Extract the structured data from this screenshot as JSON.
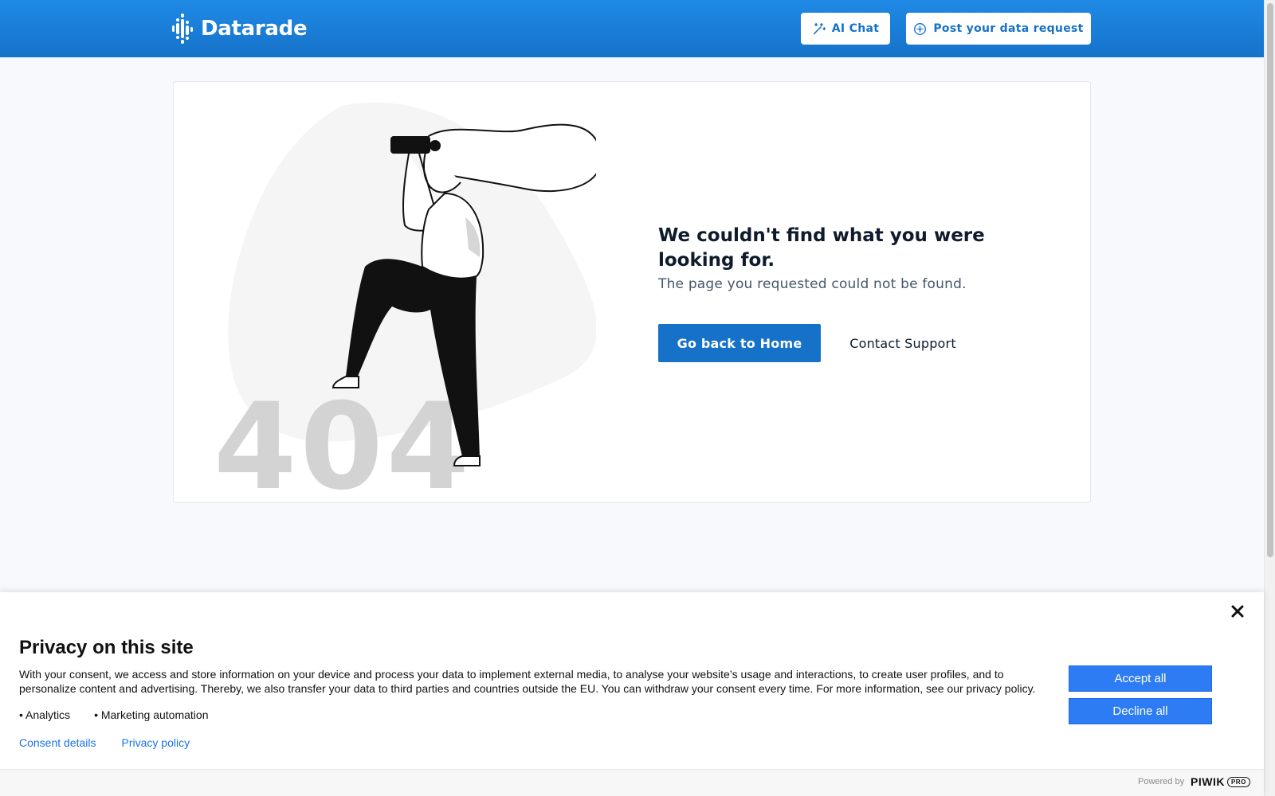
{
  "header": {
    "logo_text": "Datarade",
    "ai_chat_label": "AI Chat",
    "post_request_label": "Post your data request"
  },
  "error": {
    "code": "404",
    "title": "We couldn't find what you were looking for.",
    "subtitle": "The page you requested could not be found.",
    "home_button": "Go back to Home",
    "support_link": "Contact Support"
  },
  "consent": {
    "title": "Privacy on this site",
    "body": "With your consent, we access and store information on your device and process your data to implement external media, to analyse your website’s usage and interactions, to create user profiles, and to personalize content and advertising. Thereby, we also transfer your data to third parties and countries outside the EU. You can withdraw your consent every time. For more information, see our privacy policy.",
    "purposes": [
      "Analytics",
      "Marketing automation"
    ],
    "details_link": "Consent details",
    "privacy_link": "Privacy policy",
    "accept_label": "Accept all",
    "decline_label": "Decline all",
    "powered_by": "Powered by",
    "vendor": "PIWIK",
    "vendor_suffix": "PRO"
  },
  "colors": {
    "brand_blue": "#1672c9",
    "consent_blue": "#2d7cf3"
  }
}
